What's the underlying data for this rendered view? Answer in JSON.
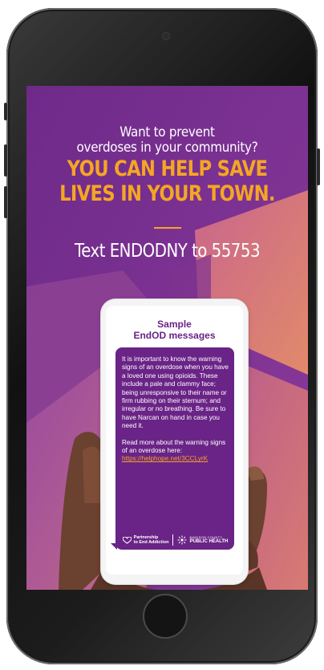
{
  "colors": {
    "background_purple": "#7a2c8e",
    "accent_orange": "#f5a623",
    "bubble_purple": "#6a2386",
    "title_purple": "#6a2386"
  },
  "ad": {
    "pre_headline": "Want to prevent\noverdoses in your community?",
    "headline": "YOU CAN HELP SAVE\nLIVES IN YOUR TOWN.",
    "cta": "Text ENDODNY to 55753"
  },
  "sample": {
    "title": "Sample\nEndOD messages",
    "message_1": "It is important to know the warning signs of an overdose when you have a loved one using opioids. These include a pale and clammy face; being unresponsive to their name or firm rubbing on their sternum; and irregular or no breathing. Be sure to have Narcan on hand in case you need it.",
    "message_2": "Read more about the warning signs of an overdose here:",
    "link": "https://helphope.net/3CCLyrK"
  },
  "logos": {
    "partnership_text": "Partnership\nto End Addiction",
    "partnership_icon": "heart-outline-icon",
    "county_small": "MADISON COUNTY",
    "county_big": "PUBLIC HEALTH",
    "county_icon": "sunburst-icon"
  }
}
